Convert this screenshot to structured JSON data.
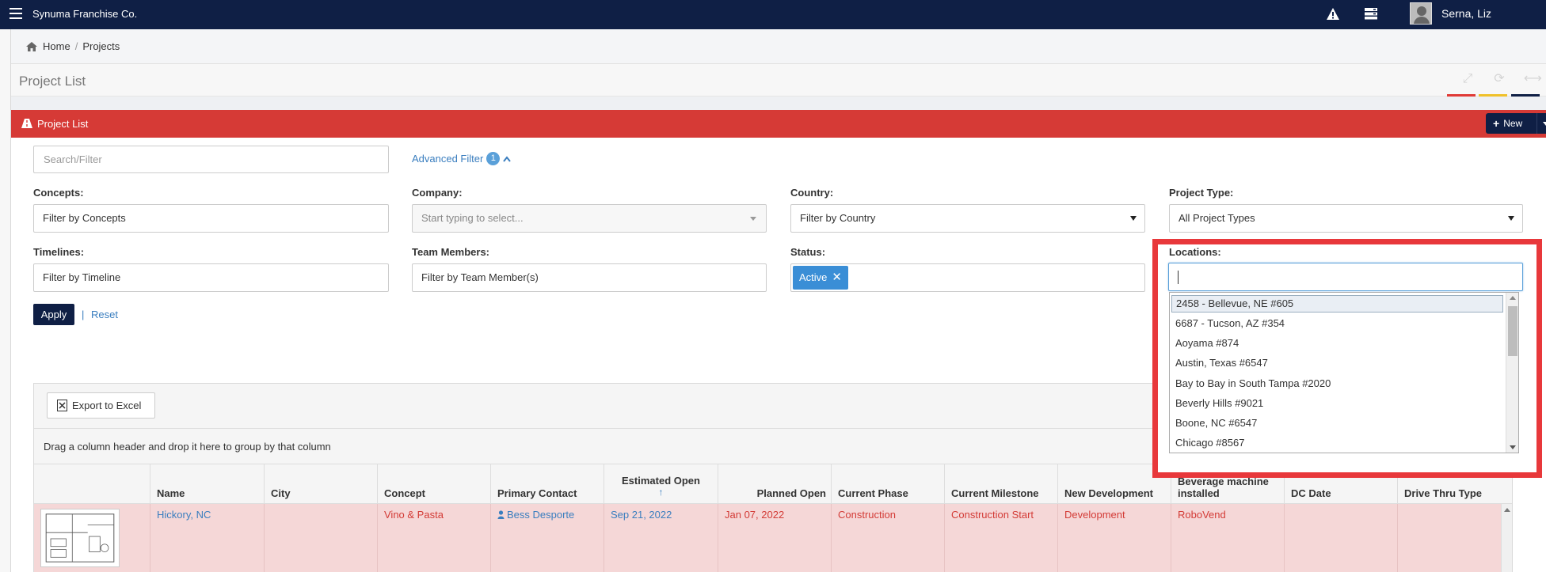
{
  "app": {
    "brand": "Synuma Franchise Co.",
    "user_name": "Serna, Liz"
  },
  "icons": {
    "warning": "warning-icon",
    "server": "server-icon",
    "home": "home-icon",
    "road": "road-icon"
  },
  "breadcrumb": {
    "home": "Home",
    "separator": "/",
    "current": "Projects"
  },
  "page": {
    "title": "Project List"
  },
  "title_tools": {
    "underline_colors": [
      "#e03a36",
      "#f0c12a",
      "#0f1f45"
    ]
  },
  "panel": {
    "title": "Project List",
    "new_button": "New",
    "new_button_plus": "+"
  },
  "filters": {
    "search_placeholder": "Search/Filter",
    "advanced_filter": "Advanced Filter",
    "advanced_filter_count": "1",
    "concepts": {
      "label": "Concepts:",
      "value": "Filter by Concepts"
    },
    "company": {
      "label": "Company:",
      "placeholder": "Start typing to select..."
    },
    "country": {
      "label": "Country:",
      "value": "Filter by Country"
    },
    "project_type": {
      "label": "Project Type:",
      "value": "All Project Types"
    },
    "timelines": {
      "label": "Timelines:",
      "value": "Filter by Timeline"
    },
    "team_members": {
      "label": "Team Members:",
      "value": "Filter by Team Member(s)"
    },
    "status": {
      "label": "Status:",
      "tag": "Active",
      "tag_remove": "✕"
    },
    "locations": {
      "label": "Locations:",
      "options": [
        "2458 - Bellevue, NE #605",
        "6687 - Tucson, AZ #354",
        "Aoyama #874",
        "Austin, Texas #6547",
        "Bay to Bay in South Tampa #2020",
        "Beverly Hills #9021",
        "Boone, NC #6547",
        "Chicago #8567"
      ]
    },
    "apply": "Apply",
    "separator": "|",
    "reset": "Reset"
  },
  "grid": {
    "export_button": "Export to Excel",
    "group_hint": "Drag a column header and drop it here to group by that column",
    "columns": [
      "Name",
      "City",
      "Concept",
      "Primary Contact",
      "Estimated Open",
      "Planned Open",
      "Current Phase",
      "Current Milestone",
      "New Development",
      "Beverage machine installed",
      "DC Date",
      "Drive Thru Type"
    ],
    "sort_indicator": "↑",
    "rows": [
      {
        "name": "Hickory, NC",
        "city": "",
        "concept": "Vino & Pasta",
        "primary_contact": "Bess Desporte",
        "estimated_open": "Sep 21, 2022",
        "planned_open": "Jan 07, 2022",
        "current_phase": "Construction",
        "current_milestone": "Construction Start",
        "new_development": "Development",
        "beverage_machine": "RoboVend",
        "dc_date": "",
        "drive_thru_type": ""
      }
    ]
  },
  "colors": {
    "navy": "#0f1f45",
    "panel_red": "#d63a36",
    "highlight_red": "#e8383b",
    "link_blue": "#3a7ebf",
    "row_pink": "#f5d7d7"
  }
}
